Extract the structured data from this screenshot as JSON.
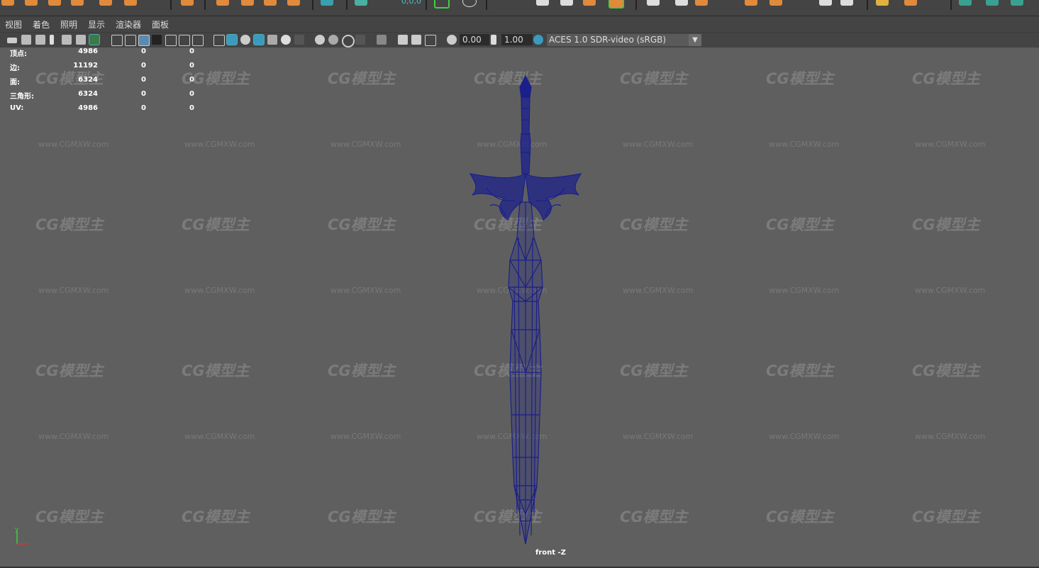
{
  "menu": [
    "视图",
    "着色",
    "照明",
    "显示",
    "渲染器",
    "面板"
  ],
  "toolbar": {
    "field1": "0.00",
    "field2": "1.00",
    "color_management": "ACES 1.0 SDR-video (sRGB)"
  },
  "shelf_number": "0,0,0",
  "hud": {
    "rows": [
      {
        "label": "顶点:",
        "v1": "4986",
        "v2": "0",
        "v3": "0"
      },
      {
        "label": "边:",
        "v1": "11192",
        "v2": "0",
        "v3": "0"
      },
      {
        "label": "面:",
        "v1": "6324",
        "v2": "0",
        "v3": "0"
      },
      {
        "label": "三角形:",
        "v1": "6324",
        "v2": "0",
        "v3": "0"
      },
      {
        "label": "UV:",
        "v1": "4986",
        "v2": "0",
        "v3": "0"
      }
    ]
  },
  "viewport": {
    "camera_label": "front -Z",
    "axis_label": "y"
  },
  "watermark": {
    "logo": "CG模型主",
    "url": "www.CGMXW.com"
  },
  "colors": {
    "wire": "#1a1f8c",
    "viewport_bg": "#5f5f5f",
    "ui_bg": "#444444"
  }
}
